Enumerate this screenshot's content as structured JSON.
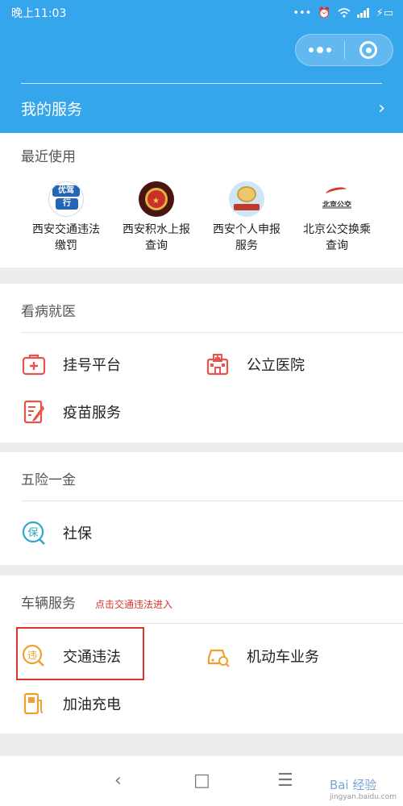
{
  "status": {
    "time": "晚上11:03",
    "icons": [
      "dots-icon",
      "alarm-icon",
      "wifi-icon",
      "signal-icon",
      "battery-charging-icon"
    ]
  },
  "header": {
    "bg_color": "#36a6ec",
    "my_services": "我的服务"
  },
  "recent": {
    "title": "最近使用",
    "items": [
      {
        "line1": "西安交通违法",
        "line2": "缴罚",
        "icon": "youjia-icon",
        "icon_text_top": "优驾",
        "icon_text_bottom": "行"
      },
      {
        "line1": "西安积水上报",
        "line2": "查询",
        "icon": "police-badge-icon"
      },
      {
        "line1": "西安个人申报",
        "line2": "服务",
        "icon": "tax-emblem-icon"
      },
      {
        "line1": "北京公交换乘",
        "line2": "查询",
        "icon": "beijing-bus-icon",
        "icon_text": "北京公交"
      }
    ]
  },
  "medical": {
    "title": "看病就医",
    "items": [
      {
        "label": "挂号平台",
        "icon": "medical-kit-icon"
      },
      {
        "label": "公立医院",
        "icon": "hospital-icon"
      },
      {
        "label": "疫苗服务",
        "icon": "vaccine-form-icon"
      }
    ]
  },
  "insurance": {
    "title": "五险一金",
    "items": [
      {
        "label": "社保",
        "icon": "social-security-icon",
        "icon_char": "保"
      }
    ]
  },
  "vehicle": {
    "title": "车辆服务",
    "annotation": "点击交通违法进入",
    "items": [
      {
        "label": "交通违法",
        "icon": "traffic-violation-icon",
        "icon_char": "违"
      },
      {
        "label": "机动车业务",
        "icon": "car-search-icon"
      },
      {
        "label": "加油充电",
        "icon": "fuel-pump-icon"
      }
    ]
  },
  "navbar": {
    "back": "‹",
    "home": "□",
    "menu": "☰"
  },
  "watermark": {
    "text": "Bai 经验",
    "sub": "jingyan.baidu.com"
  },
  "colors": {
    "accent": "#36a6ec",
    "icon_red": "#e8534a",
    "icon_orange": "#f0a030",
    "icon_teal": "#2fa7c6",
    "highlight": "#d9342b"
  }
}
